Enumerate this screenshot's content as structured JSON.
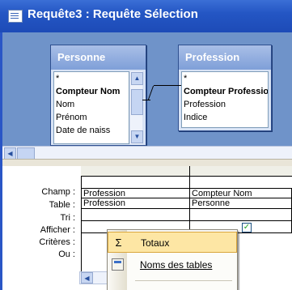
{
  "window": {
    "title": "Requête3 : Requête Sélection"
  },
  "tables": [
    {
      "name": "Personne",
      "fields": [
        "*",
        "Compteur Nom",
        "Nom",
        "Prénom",
        "Date de naiss"
      ],
      "primary_key": "Compteur Nom"
    },
    {
      "name": "Profession",
      "fields": [
        "*",
        "Compteur Profession",
        "Profession",
        "Indice"
      ],
      "primary_key": "Compteur Profession"
    }
  ],
  "grid": {
    "row_labels": [
      "Champ :",
      "Table :",
      "Tri :",
      "Afficher :",
      "Critères :",
      "Ou :"
    ],
    "columns": [
      {
        "champ": "Profession",
        "table": "Profession",
        "afficher": true
      },
      {
        "champ": "Compteur Nom",
        "table": "Personne",
        "afficher": true
      }
    ]
  },
  "context_menu": {
    "items": [
      {
        "label": "Totaux",
        "accelerator": "x",
        "icon": "sigma-icon",
        "highlighted": true
      },
      {
        "label": "Noms des tables",
        "accelerator": "N",
        "icon": "table-names-icon",
        "highlighted": false
      }
    ]
  }
}
